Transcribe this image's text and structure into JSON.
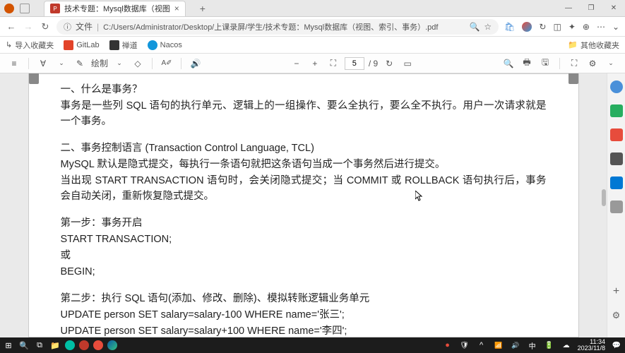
{
  "titlebar": {
    "tab_title": "技术专题：Mysql数据库（视图",
    "add_tab": "+"
  },
  "window_controls": {
    "min": "—",
    "max": "❐",
    "close": "✕"
  },
  "addressbar": {
    "file_label": "文件",
    "url": "C:/Users/Administrator/Desktop/上课录屏/学生/技术专题：Mysql数据库（视图、索引、事务）.pdf"
  },
  "bookmarks": {
    "import": "导入收藏夹",
    "items": [
      "GitLab",
      "禅道",
      "Nacos"
    ],
    "other": "其他收藏夹"
  },
  "pdf_toolbar": {
    "draw": "绘制",
    "draw_caret": "⌄",
    "page_current": "5",
    "page_total": "/ 9"
  },
  "document": {
    "lines": [
      "一、什么是事务？",
      "事务是一些列 SQL 语句的执行单元、逻辑上的一组操作、要么全执行，要么全不执行。用户一次请求就是一个事务。",
      "",
      "二、事务控制语言  (Transaction Control Language, TCL)",
      "MySQL  默认是隐式提交，每执行一条语句就把这条语句当成一个事务然后进行提交。",
      "当出现  START TRANSACTION  语句时，会关闭隐式提交；当  COMMIT  或  ROLLBACK  语句执行后，事务会自动关闭，重新恢复隐式提交。",
      "",
      "第一步：事务开启",
      "START TRANSACTION;",
      "或",
      "BEGIN;",
      "",
      "第二步：执行 SQL 语句(添加、修改、删除)、模拟转账逻辑业务单元",
      "UPDATE person SET salary=salary-100 WHERE name='张三';",
      "UPDATE person SET salary=salary+100 WHERE name='李四';"
    ]
  },
  "system": {
    "time": "11:34",
    "date": "2023/11/8"
  }
}
